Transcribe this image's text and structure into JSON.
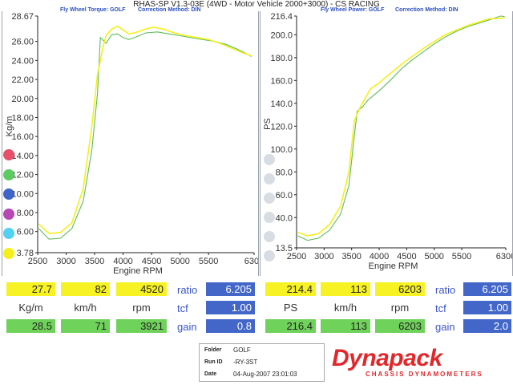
{
  "header": {
    "title": "RHAS-SP V1.3-03E  (4WD - Motor Vehicle 2000+3000) - CS RACING",
    "left_subtitle": "Fly Wheel Torque: GOLF",
    "left_correction": "Correction Method: DIN",
    "right_subtitle": "Fly Wheel Power: GOLF",
    "right_correction": "Correction Method: DIN"
  },
  "colors": {
    "series1": "#f5ef1c",
    "series2": "#5ebd5a",
    "axis": "#222222",
    "blue_cell": "#4367c9",
    "brand_red": "#e0282c"
  },
  "legend_dots": [
    "#e8506a",
    "#5ccc62",
    "#3e64c8",
    "#b647b5",
    "#54d0f0",
    "#f5ef1c"
  ],
  "chart_data": [
    {
      "type": "line",
      "title": "",
      "xlabel": "Engine RPM",
      "ylabel": "Kg/m",
      "xlim": [
        2500,
        6300
      ],
      "ylim": [
        3.78,
        28.67
      ],
      "x_ticks": [
        "2500",
        "3000",
        "3500",
        "4000",
        "4500",
        "5000",
        "5500",
        "6300"
      ],
      "y_ticks": [
        "28.67",
        "26.00",
        "24.00",
        "22.00",
        "20.00",
        "18.00",
        "16.00",
        "14.00",
        "12.00",
        "10.00",
        "8.00",
        "6.00",
        "3.78"
      ],
      "grid": false,
      "series": [
        {
          "name": "",
          "x": [
            2520,
            2700,
            2900,
            3100,
            3300,
            3450,
            3550,
            3650,
            3700,
            3800,
            3900,
            4000,
            4100,
            4200,
            4400,
            4520,
            4700,
            4900,
            5100,
            5300,
            5500,
            5700,
            5900,
            6100,
            6250
          ],
          "y": [
            6.8,
            5.8,
            5.9,
            6.9,
            10.5,
            17.0,
            22.5,
            25.5,
            26.6,
            27.3,
            27.6,
            27.2,
            26.8,
            26.9,
            27.3,
            27.5,
            27.3,
            26.9,
            26.6,
            26.4,
            26.2,
            25.8,
            25.3,
            24.8,
            24.5
          ]
        },
        {
          "name": "",
          "x": [
            2520,
            2700,
            2900,
            3100,
            3300,
            3450,
            3550,
            3600,
            3700,
            3800,
            3900,
            4000,
            4100,
            4200,
            4400,
            4600,
            4800,
            5000,
            5200,
            5400,
            5600,
            5800,
            6000,
            6200,
            6250
          ],
          "y": [
            6.3,
            5.2,
            5.3,
            6.3,
            9.2,
            14.5,
            20.5,
            26.4,
            25.8,
            26.7,
            26.8,
            26.4,
            26.2,
            26.4,
            26.9,
            27.0,
            26.8,
            26.6,
            26.4,
            26.2,
            26.0,
            25.7,
            25.2,
            24.6,
            24.4
          ]
        }
      ]
    },
    {
      "type": "line",
      "title": "",
      "xlabel": "Engine RPM",
      "ylabel": "PS",
      "xlim": [
        2500,
        6300
      ],
      "ylim": [
        13.5,
        216.4
      ],
      "x_ticks": [
        "2500",
        "3000",
        "3500",
        "4000",
        "4500",
        "5000",
        "5500",
        "6300"
      ],
      "y_ticks": [
        "216.4",
        "200.0",
        "180.0",
        "160.0",
        "140.0",
        "120.0",
        "100.0",
        "80.0",
        "60.0",
        "40.0",
        "13.5"
      ],
      "grid": false,
      "series": [
        {
          "name": "",
          "x": [
            2520,
            2700,
            2900,
            3100,
            3300,
            3450,
            3550,
            3650,
            3750,
            3850,
            4000,
            4200,
            4400,
            4600,
            4800,
            5000,
            5200,
            5400,
            5600,
            5800,
            6000,
            6203,
            6280
          ],
          "y": [
            27,
            24,
            26,
            34,
            50,
            80,
            125,
            136,
            145,
            153,
            158,
            166,
            174,
            181,
            188,
            194,
            200,
            204,
            208,
            211,
            214,
            214.4,
            215
          ]
        },
        {
          "name": "",
          "x": [
            2520,
            2700,
            2900,
            3100,
            3300,
            3450,
            3550,
            3600,
            3700,
            3800,
            3900,
            4000,
            4200,
            4400,
            4600,
            4800,
            5000,
            5200,
            5400,
            5600,
            5800,
            6000,
            6203,
            6280
          ],
          "y": [
            24,
            20,
            22,
            29,
            43,
            68,
            112,
            133,
            137,
            143,
            147,
            151,
            160,
            170,
            178,
            185,
            192,
            198,
            203,
            207,
            210,
            213,
            216.4,
            216
          ]
        }
      ]
    }
  ],
  "readout": {
    "left": {
      "row1": [
        "27.7",
        "82",
        "4520"
      ],
      "labels": [
        "Kg/m",
        "km/h",
        "rpm"
      ],
      "row3": [
        "28.5",
        "71",
        "3921"
      ],
      "side_labels": [
        "ratio",
        "tcf",
        "gain"
      ],
      "side_values": [
        "6.205",
        "1.00",
        "0.8"
      ]
    },
    "right": {
      "row1": [
        "214.4",
        "113",
        "6203"
      ],
      "labels": [
        "PS",
        "km/h",
        "rpm"
      ],
      "row3": [
        "216.4",
        "113",
        "6203"
      ],
      "side_labels": [
        "ratio",
        "tcf",
        "gain"
      ],
      "side_values": [
        "6.205",
        "1.00",
        "2.0"
      ]
    }
  },
  "info": {
    "folder_label": "Folder",
    "folder_value": "GOLF",
    "run_label": "Run ID",
    "run_value": "-RY-3ST",
    "date_label": "Date",
    "date_value": "04-Aug-2007  23:01:03"
  },
  "logo": {
    "main": "Dynapack",
    "sub": "CHASSIS DYNAMOMETERS"
  }
}
